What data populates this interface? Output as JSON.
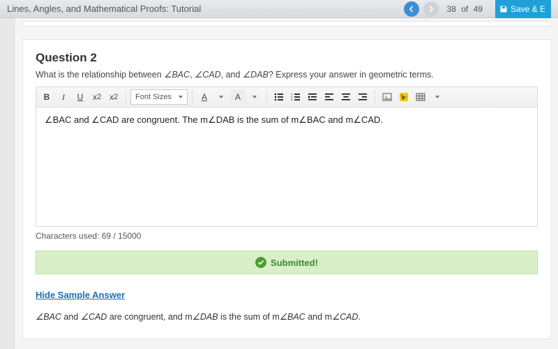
{
  "topbar": {
    "title": "Lines, Angles, and Mathematical Proofs: Tutorial",
    "page_current": "38",
    "page_sep": "of",
    "page_total": "49",
    "save_label": "Save & E"
  },
  "question": {
    "heading": "Question 2",
    "prompt_pre": "What is the relationship between ",
    "a1": "∠BAC",
    "sep1": ", ",
    "a2": "∠CAD",
    "sep2": ", and ",
    "a3": "∠DAB",
    "prompt_post": "? Express your answer in geometric terms."
  },
  "toolbar": {
    "bold": "B",
    "italic": "I",
    "underline": "U",
    "sup": "x",
    "sup_exp": "2",
    "sub": "x",
    "sub_exp": "2",
    "fontsize_label": "Font Sizes",
    "textcolor": "A",
    "bgcolor": "A"
  },
  "editor": {
    "content": "∠BAC and ∠CAD are congruent. The m∠DAB is the sum of m∠BAC and m∠CAD."
  },
  "counter": {
    "label": "Characters used: 69 / 15000"
  },
  "status": {
    "submitted": "Submitted!"
  },
  "sample": {
    "toggle": "Hide Sample Answer",
    "pre": "",
    "a1": "∠BAC",
    "t1": " and ",
    "a2": "∠CAD",
    "t2": " are congruent, and m",
    "a3": "∠DAB",
    "t3": " is the sum of m",
    "a4": "∠BAC",
    "t4": " and m",
    "a5": "∠CAD",
    "t5": "."
  }
}
